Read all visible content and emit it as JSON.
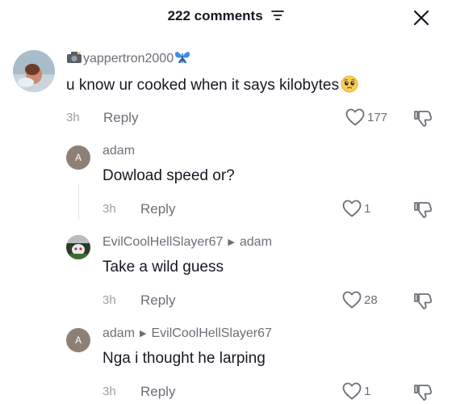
{
  "header": {
    "title": "222 comments"
  },
  "comments": [
    {
      "username": "yappertron2000",
      "text": "u know ur cooked when it says kilobytes",
      "time": "3h",
      "reply_label": "Reply",
      "likes": "177"
    }
  ],
  "replies": [
    {
      "avatar_letter": "A",
      "username": "adam",
      "reply_to": "",
      "text": "Dowload speed or?",
      "time": "3h",
      "reply_label": "Reply",
      "likes": "1"
    },
    {
      "avatar_letter": "",
      "username": "EvilCoolHellSlayer67",
      "reply_to": "adam",
      "text": "Take a wild guess",
      "time": "3h",
      "reply_label": "Reply",
      "likes": "28"
    },
    {
      "avatar_letter": "A",
      "username": "adam",
      "reply_to": "EvilCoolHellSlayer67",
      "text": "Nga i thought he larping",
      "time": "3h",
      "reply_label": "Reply",
      "likes": "1"
    }
  ],
  "colors": {
    "text": "#161823",
    "secondary": "#6b6f77",
    "muted": "#9a9ca2",
    "avatar_letter_bg": "#8e8075"
  },
  "icons": [
    "filter-icon",
    "close-icon",
    "camera-emoji",
    "butterfly-emoji",
    "pleading-face-emoji",
    "heart-icon",
    "dislike-icon"
  ]
}
